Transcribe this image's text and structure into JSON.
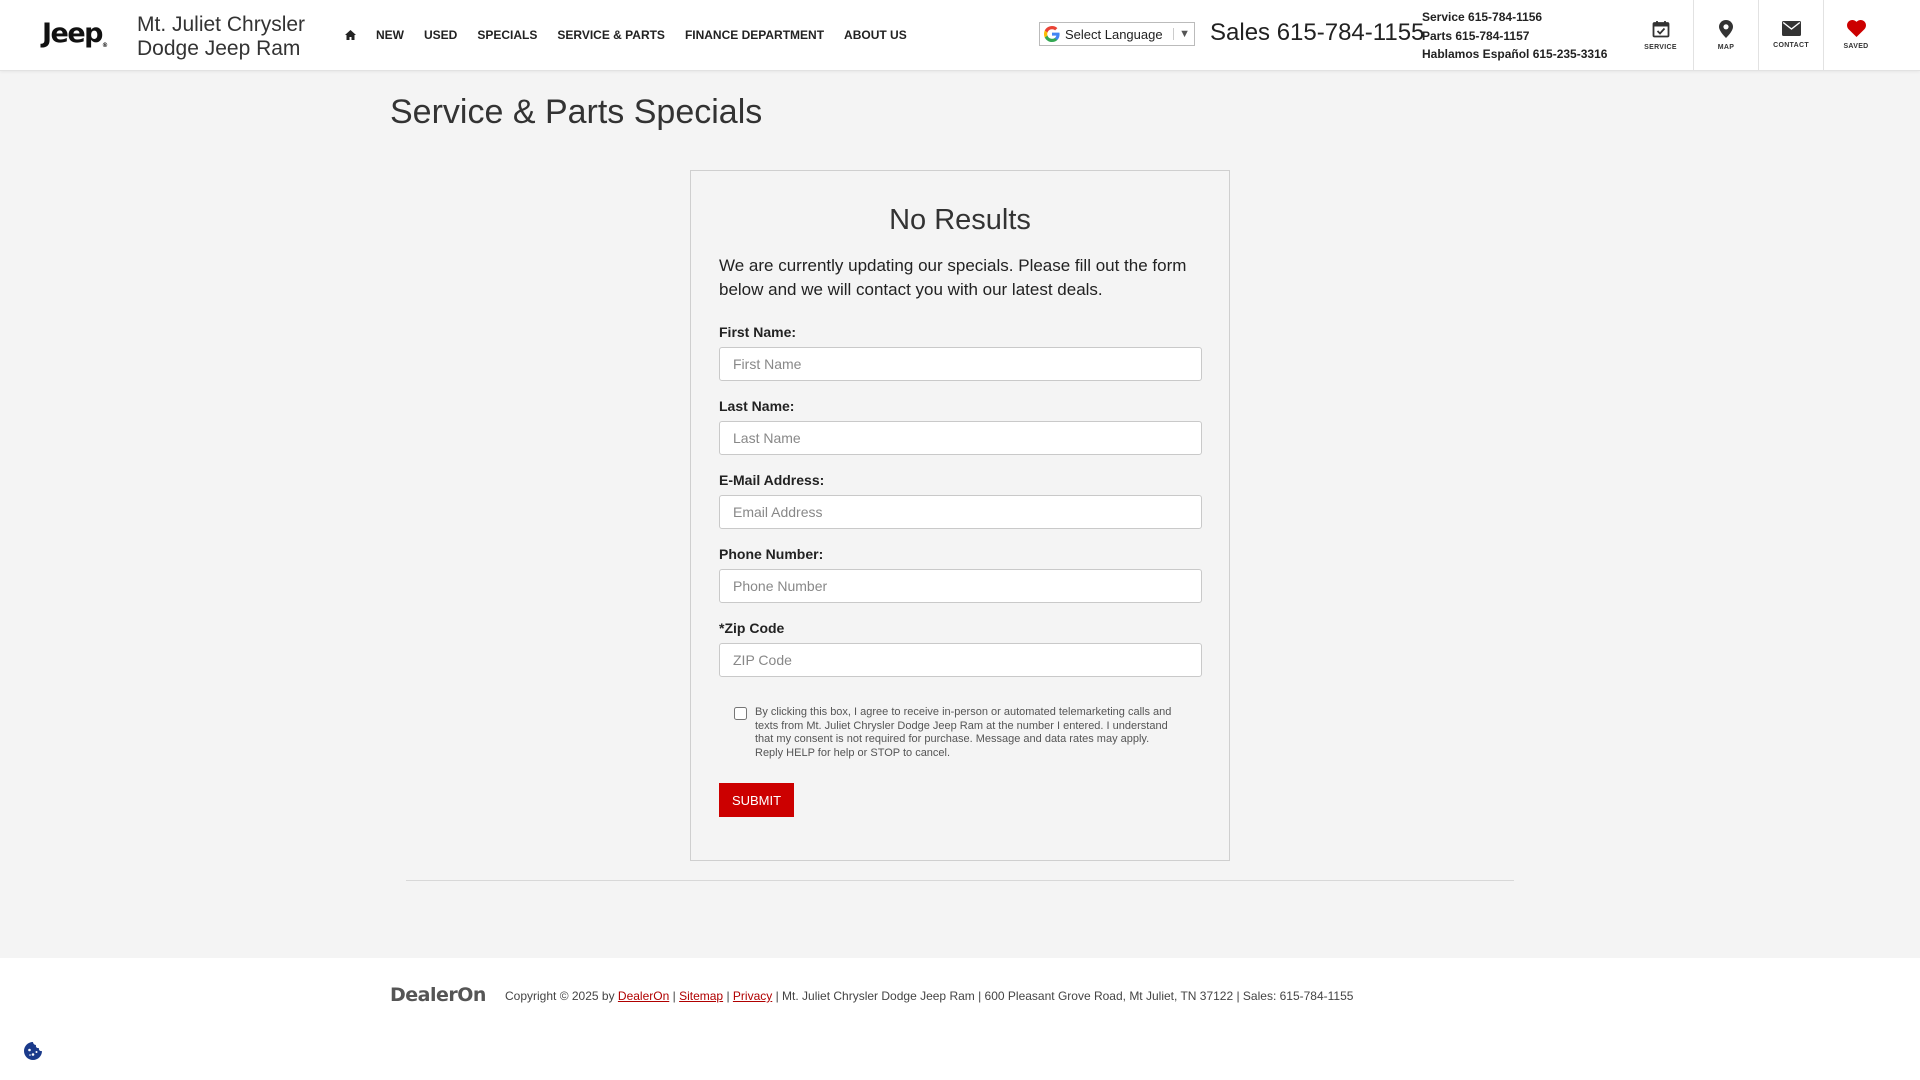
{
  "header": {
    "logo_text": "Jeep",
    "logo_mark": "®",
    "dealer_name": "Mt. Juliet Chrysler Dodge Jeep Ram",
    "nav": [
      {
        "icon": "home-icon",
        "label": ""
      },
      {
        "label": "NEW"
      },
      {
        "label": "USED"
      },
      {
        "label": "SPECIALS"
      },
      {
        "label": "SERVICE & PARTS"
      },
      {
        "label": "FINANCE DEPARTMENT"
      },
      {
        "label": "ABOUT US"
      }
    ],
    "language": {
      "label": "Select Language",
      "arrow": "▼"
    },
    "sales": "Sales 615-784-1155",
    "phones": [
      "Service 615-784-1156",
      "Parts 615-784-1157",
      "Hablamos Español 615-235-3316"
    ],
    "quick_links": [
      {
        "label": "SERVICE",
        "icon": "calendar-check-icon"
      },
      {
        "label": "MAP",
        "icon": "map-pin-icon"
      },
      {
        "label": "CONTACT",
        "icon": "envelope-icon"
      },
      {
        "label": "SAVED",
        "icon": "heart-icon"
      }
    ]
  },
  "main": {
    "title": "Service & Parts Specials",
    "card": {
      "title": "No Results",
      "description": "We are currently updating our specials. Please fill out the form below and we will contact you with our latest deals.",
      "fields": [
        {
          "label": "First Name:",
          "placeholder": "First Name",
          "value": ""
        },
        {
          "label": "Last Name:",
          "placeholder": "Last Name",
          "value": ""
        },
        {
          "label": "E-Mail Address:",
          "placeholder": "Email Address",
          "value": ""
        },
        {
          "label": "Phone Number:",
          "placeholder": "Phone Number",
          "value": ""
        },
        {
          "label": "*Zip Code",
          "placeholder": "ZIP Code",
          "value": ""
        }
      ],
      "consent": {
        "checked": false,
        "text": "By clicking this box, I agree to receive in-person or automated telemarketing calls and texts from Mt. Juliet Chrysler Dodge Jeep Ram at the number I entered. I understand that my consent is not required for purchase. Message and data rates may apply. Reply HELP for help or STOP to cancel."
      },
      "submit_label": "SUBMIT"
    }
  },
  "footer": {
    "logo_text": "DealerOn",
    "copyright": "Copyright © 2025 by",
    "link_dealeron": "DealerOn",
    "sep1": " | ",
    "link_sitemap": "Sitemap",
    "sep2": " | ",
    "link_privacy": "Privacy",
    "info": " | Mt. Juliet Chrysler Dodge Jeep Ram | 600 Pleasant Grove Road, Mt Juliet, TN 37122 | Sales: 615-784-1155"
  },
  "colors": {
    "accent": "#cc0000",
    "saved_heart": "#cc0000",
    "cookie_icon": "#1a3a8a"
  }
}
